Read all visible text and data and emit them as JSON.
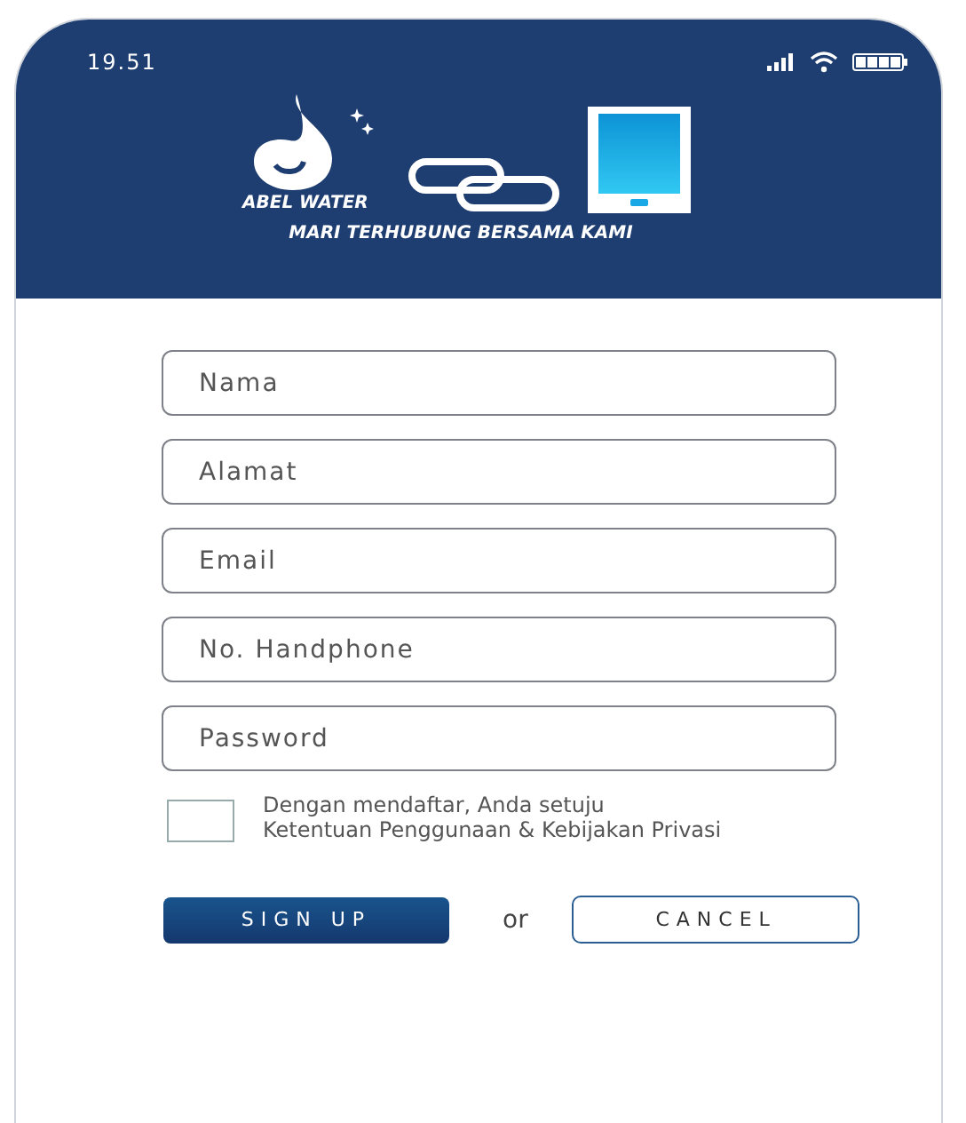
{
  "status_bar": {
    "time": "19.51"
  },
  "header": {
    "brand": "ABEL WATER",
    "tagline": "MARI TERHUBUNG BERSAMA KAMI"
  },
  "fields": [
    {
      "placeholder": "Nama"
    },
    {
      "placeholder": "Alamat"
    },
    {
      "placeholder": "Email"
    },
    {
      "placeholder": "No. Handphone"
    },
    {
      "placeholder": "Password"
    }
  ],
  "agreement": {
    "checked": false,
    "line_1": "Dengan mendaftar, Anda setuju",
    "line_2": "Ketentuan Penggunaan & Kebijakan Privasi"
  },
  "buttons": {
    "primary": "SIGN UP",
    "separator": "or",
    "secondary": "CANCEL"
  }
}
